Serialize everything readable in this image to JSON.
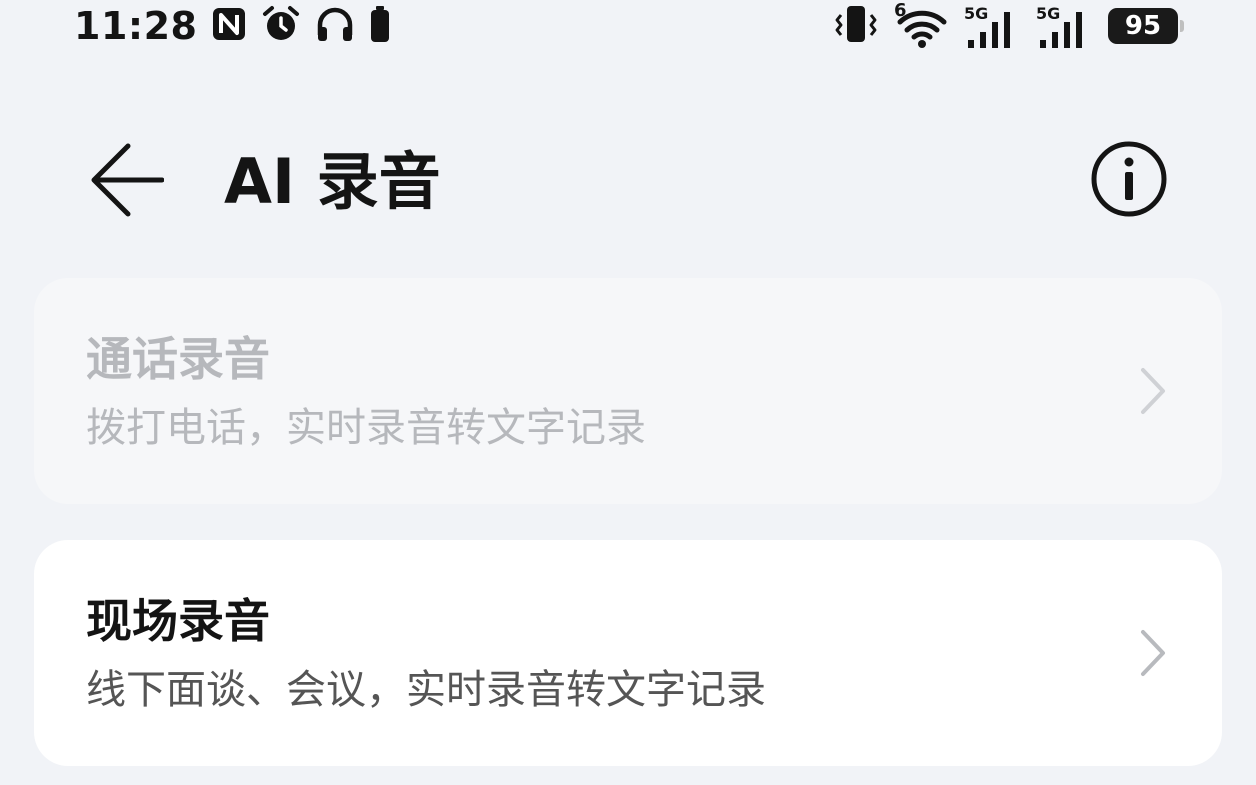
{
  "status_bar": {
    "time": "11:28",
    "wifi_badge": "6",
    "sim1_network": "5G",
    "sim2_network": "5G",
    "battery_level": "95",
    "icons": [
      "nfc-icon",
      "alarm-icon",
      "headphones-icon",
      "small-battery-icon",
      "vibrate-icon",
      "wifi-icon",
      "signal-icon"
    ]
  },
  "header": {
    "title": "AI 录音",
    "back_icon": "arrow-left-icon",
    "info_icon": "info-circle-icon"
  },
  "options": [
    {
      "title": "通话录音",
      "subtitle": "拨打电话，实时录音转文字记录",
      "enabled": false
    },
    {
      "title": "现场录音",
      "subtitle": "线下面谈、会议，实时录音转文字记录",
      "enabled": true
    }
  ],
  "colors": {
    "background": "#f1f3f7",
    "card": "#ffffff",
    "card_disabled": "#f6f7f9",
    "text_primary": "#141414",
    "text_secondary": "#555555",
    "text_disabled": "#b6b8bc"
  }
}
